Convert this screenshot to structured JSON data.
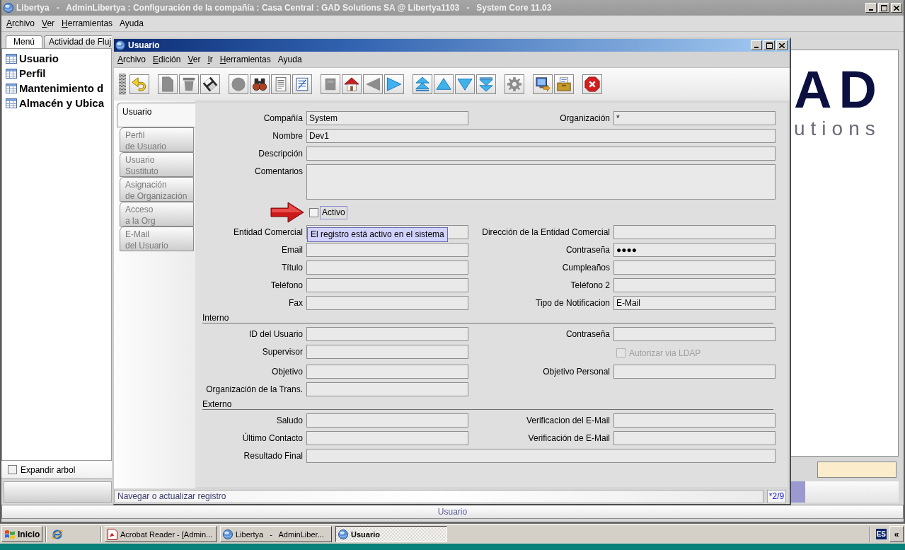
{
  "window": {
    "title": "Libertya   -   AdminLibertya : Configuración de la compañía : Casa Central : GAD Solutions SA @ Libertya1103   -   System Core 11.03"
  },
  "menu": [
    {
      "label": "Archivo",
      "mnemonic": true
    },
    {
      "label": "Ver",
      "mnemonic": true
    },
    {
      "label": "Herramientas",
      "mnemonic": true
    },
    {
      "label": "Ayuda",
      "mnemonic": false
    }
  ],
  "side_tabs": [
    {
      "label": "Menú",
      "selected": true
    },
    {
      "label": "Actividad de Fluj",
      "selected": false
    }
  ],
  "tree": {
    "items": [
      {
        "label": "Usuario"
      },
      {
        "label": "Perfil"
      },
      {
        "label": "Mantenimiento d"
      },
      {
        "label": "Almacén y Ubica"
      }
    ]
  },
  "expand_tree": {
    "label": "Expandir arbol",
    "checked": false
  },
  "logo": {
    "mark": "AD",
    "tagline": "utions"
  },
  "status_bar": {
    "text": "Usuario"
  },
  "dialog": {
    "title": "Usuario",
    "menu": [
      {
        "label": "Archivo",
        "mnemonic": true
      },
      {
        "label": "Edición",
        "mnemonic": true
      },
      {
        "label": "Ver",
        "mnemonic": true
      },
      {
        "label": "Ir",
        "mnemonic": true
      },
      {
        "label": "Herramientas",
        "mnemonic": true
      },
      {
        "label": "Ayuda",
        "mnemonic": false
      }
    ],
    "toolbar": {
      "groups": [
        [
          {
            "kind": "undo",
            "disabled": false
          }
        ],
        [
          {
            "kind": "new",
            "disabled": true
          },
          {
            "kind": "delete",
            "disabled": true
          },
          {
            "kind": "save",
            "disabled": false
          }
        ],
        [
          {
            "kind": "refresh",
            "disabled": true
          },
          {
            "kind": "find",
            "disabled": false
          },
          {
            "kind": "report",
            "disabled": false
          },
          {
            "kind": "grid",
            "disabled": false
          }
        ],
        [
          {
            "kind": "detail",
            "disabled": true
          },
          {
            "kind": "home",
            "disabled": false
          },
          {
            "kind": "back",
            "disabled": true
          },
          {
            "kind": "forward",
            "disabled": false
          }
        ],
        [
          {
            "kind": "first",
            "disabled": false
          },
          {
            "kind": "previous",
            "disabled": false
          },
          {
            "kind": "next",
            "disabled": false
          },
          {
            "kind": "last",
            "disabled": false
          }
        ],
        [
          {
            "kind": "workflow",
            "disabled": true
          }
        ],
        [
          {
            "kind": "export",
            "disabled": false
          },
          {
            "kind": "archive",
            "disabled": false
          }
        ],
        [
          {
            "kind": "exit",
            "disabled": false
          }
        ]
      ]
    },
    "tabs": [
      {
        "label": "Usuario",
        "selected": true
      },
      {
        "label": "Perfil\nde Usuario",
        "selected": false
      },
      {
        "label": "Usuario\nSustituto",
        "selected": false
      },
      {
        "label": "Asignación\nde Organización",
        "selected": false
      },
      {
        "label": "Acceso\na la Org",
        "selected": false
      },
      {
        "label": "E-Mail\ndel Usuario",
        "selected": false
      }
    ],
    "form": {
      "rows": [
        {
          "kind": "pair",
          "left": {
            "label": "Compañía",
            "value": "System"
          },
          "right": {
            "label": "Organización",
            "value": "*"
          }
        },
        {
          "kind": "wide",
          "label": "Nombre",
          "value": "Dev1"
        },
        {
          "kind": "wide",
          "label": "Descripción"
        },
        {
          "kind": "memo",
          "label": "Comentarios"
        },
        {
          "kind": "check",
          "label": "Activo",
          "checked": false,
          "focused": true,
          "marked": true,
          "tooltip": "El registro está activo en el sistema"
        },
        {
          "kind": "pair",
          "left": {
            "label": "Entidad Comercial"
          },
          "right": {
            "label": "Dirección de la Entidad Comercial"
          }
        },
        {
          "kind": "pair",
          "left": {
            "label": "Email"
          },
          "right": {
            "label": "Contraseña",
            "value": "●●●●"
          }
        },
        {
          "kind": "pair",
          "left": {
            "label": "Título"
          },
          "right": {
            "label": "Cumpleaños"
          }
        },
        {
          "kind": "pair",
          "left": {
            "label": "Teléfono"
          },
          "right": {
            "label": "Teléfono 2"
          }
        },
        {
          "kind": "pair",
          "left": {
            "label": "Fax"
          },
          "right": {
            "label": "Tipo de Notificacion",
            "value": "E-Mail"
          }
        },
        {
          "kind": "section",
          "title": "Interno"
        },
        {
          "kind": "pair",
          "left": {
            "label": "ID del Usuario"
          },
          "right": {
            "label": "Contraseña"
          }
        },
        {
          "kind": "pair",
          "left": {
            "label": "Supervisor"
          },
          "right": {
            "kind": "check",
            "label": "Autorizar via LDAP",
            "checked": false,
            "disabled": true
          }
        },
        {
          "kind": "pair",
          "left": {
            "label": "Objetivo"
          },
          "right": {
            "label": "Objetivo Personal"
          }
        },
        {
          "kind": "pair",
          "left": {
            "label": "Organización de la Trans."
          }
        },
        {
          "kind": "section",
          "title": "Externo"
        },
        {
          "kind": "pair",
          "left": {
            "label": "Saludo"
          },
          "right": {
            "label": "Verificacion del E-Mail"
          }
        },
        {
          "kind": "pair",
          "left": {
            "label": "Último Contacto"
          },
          "right": {
            "label": "Verificación de E-Mail"
          }
        },
        {
          "kind": "wide",
          "label": "Resultado Final"
        }
      ]
    },
    "status_bar": {
      "message": "Navegar o actualizar registro",
      "record": "*2/9"
    }
  },
  "taskbar": {
    "start": "Inicio",
    "tasks": [
      {
        "kind": "pdf",
        "label": "Acrobat Reader - [Admin...",
        "selected": false
      },
      {
        "kind": "app",
        "label": "Libertya   -   AdminLiber...",
        "selected": false
      },
      {
        "kind": "app",
        "label": "Usuario",
        "selected": true
      }
    ],
    "tray": {
      "language": "ES",
      "expand": "«"
    }
  }
}
